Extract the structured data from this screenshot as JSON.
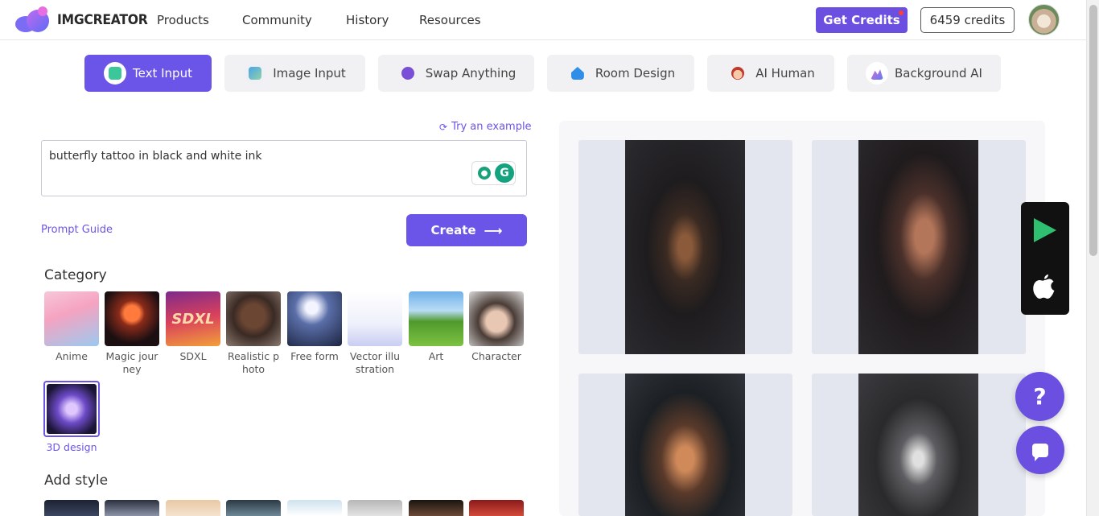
{
  "header": {
    "logo_text": "IMGCREATOR",
    "nav": [
      "Products",
      "Community",
      "History",
      "Resources"
    ],
    "get_credits_label": "Get Credits",
    "credits_label": "6459 credits"
  },
  "tabs": [
    {
      "label": "Text Input",
      "active": true,
      "icon": "text-input-icon"
    },
    {
      "label": "Image Input",
      "active": false,
      "icon": "image-input-icon"
    },
    {
      "label": "Swap Anything",
      "active": false,
      "icon": "palette-icon"
    },
    {
      "label": "Room Design",
      "active": false,
      "icon": "house-icon"
    },
    {
      "label": "AI Human",
      "active": false,
      "icon": "human-face-icon"
    },
    {
      "label": "Background AI",
      "active": false,
      "icon": "background-ai-icon"
    }
  ],
  "prompt": {
    "try_example_label": "Try an example",
    "value": "butterfly tattoo in black and white ink",
    "guide_label": "Prompt Guide",
    "create_label": "Create",
    "create_arrow": "⟶"
  },
  "category": {
    "title": "Category",
    "items": [
      {
        "label": "Anime"
      },
      {
        "label": "Magic journey"
      },
      {
        "label": "SDXL"
      },
      {
        "label": "Realistic photo"
      },
      {
        "label": "Free form"
      },
      {
        "label": "Vector illustration"
      },
      {
        "label": "Art"
      },
      {
        "label": "Character"
      },
      {
        "label": "3D design",
        "selected": true
      }
    ]
  },
  "add_style": {
    "title": "Add style"
  },
  "floating": {
    "help_label": "?",
    "apple_glyph": ""
  },
  "colors": {
    "accent": "#6b55e8",
    "get_credits_bg": "#6b4fe0"
  }
}
